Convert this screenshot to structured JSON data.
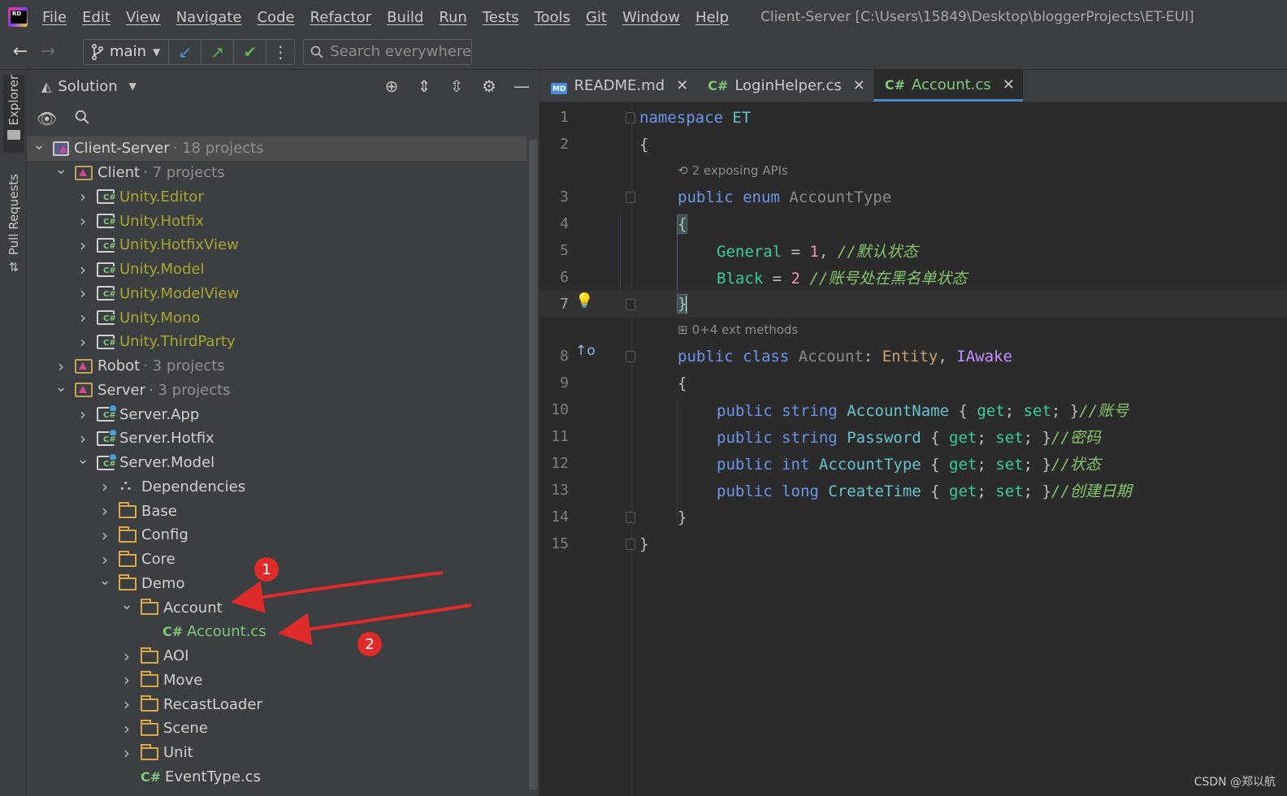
{
  "menu": {
    "items": [
      "File",
      "Edit",
      "View",
      "Navigate",
      "Code",
      "Refactor",
      "Build",
      "Run",
      "Tests",
      "Tools",
      "Git",
      "Window",
      "Help"
    ],
    "window_title": "Client-Server [C:\\Users\\15849\\Desktop\\bloggerProjects\\ET-EUI]"
  },
  "toolbar": {
    "back_icon": "arrow-left-icon",
    "forward_icon": "arrow-right-icon",
    "branch": "main",
    "search_placeholder": "Search everywhere",
    "colors": {
      "update": "#4a8fe0",
      "push": "#5ab34d",
      "commit": "#5ab34d"
    }
  },
  "side_strip": {
    "explorer": "Explorer",
    "pull_requests": "Pull Requests"
  },
  "explorer": {
    "title": "Solution",
    "tree": [
      {
        "label": "Client-Server",
        "meta": "· 18 projects",
        "level": 0,
        "expanded": true,
        "icon": "solution-icon",
        "style": "normal",
        "selected": true
      },
      {
        "label": "Client",
        "meta": "· 7 projects",
        "level": 1,
        "expanded": true,
        "icon": "solution-folder-icon",
        "style": "normal"
      },
      {
        "label": "Unity.Editor",
        "meta": "",
        "level": 2,
        "expanded": false,
        "icon": "csharp-project-icon",
        "style": "unity"
      },
      {
        "label": "Unity.Hotfix",
        "meta": "",
        "level": 2,
        "expanded": false,
        "icon": "csharp-project-icon",
        "style": "unity"
      },
      {
        "label": "Unity.HotfixView",
        "meta": "",
        "level": 2,
        "expanded": false,
        "icon": "csharp-project-icon",
        "style": "unity"
      },
      {
        "label": "Unity.Model",
        "meta": "",
        "level": 2,
        "expanded": false,
        "icon": "csharp-project-icon",
        "style": "unity"
      },
      {
        "label": "Unity.ModelView",
        "meta": "",
        "level": 2,
        "expanded": false,
        "icon": "csharp-project-icon",
        "style": "unity"
      },
      {
        "label": "Unity.Mono",
        "meta": "",
        "level": 2,
        "expanded": false,
        "icon": "csharp-project-icon",
        "style": "unity"
      },
      {
        "label": "Unity.ThirdParty",
        "meta": "",
        "level": 2,
        "expanded": false,
        "icon": "csharp-project-icon",
        "style": "unity"
      },
      {
        "label": "Robot",
        "meta": "· 3 projects",
        "level": 1,
        "expanded": false,
        "icon": "solution-folder-icon",
        "style": "normal"
      },
      {
        "label": "Server",
        "meta": "· 3 projects",
        "level": 1,
        "expanded": true,
        "icon": "solution-folder-icon",
        "style": "normal"
      },
      {
        "label": "Server.App",
        "meta": "",
        "level": 2,
        "expanded": false,
        "icon": "server-project-icon",
        "style": "normal"
      },
      {
        "label": "Server.Hotfix",
        "meta": "",
        "level": 2,
        "expanded": false,
        "icon": "server-project-icon",
        "style": "normal"
      },
      {
        "label": "Server.Model",
        "meta": "",
        "level": 2,
        "expanded": true,
        "icon": "server-project-icon",
        "style": "normal"
      },
      {
        "label": "Dependencies",
        "meta": "",
        "level": 3,
        "expanded": false,
        "icon": "dependencies-icon",
        "style": "normal"
      },
      {
        "label": "Base",
        "meta": "",
        "level": 3,
        "expanded": false,
        "icon": "folder-icon",
        "style": "normal"
      },
      {
        "label": "Config",
        "meta": "",
        "level": 3,
        "expanded": false,
        "icon": "folder-icon",
        "style": "normal"
      },
      {
        "label": "Core",
        "meta": "",
        "level": 3,
        "expanded": false,
        "icon": "folder-icon",
        "style": "normal"
      },
      {
        "label": "Demo",
        "meta": "",
        "level": 3,
        "expanded": true,
        "icon": "folder-icon",
        "style": "normal"
      },
      {
        "label": "Account",
        "meta": "",
        "level": 4,
        "expanded": true,
        "icon": "folder-icon",
        "style": "normal"
      },
      {
        "label": "Account.cs",
        "meta": "",
        "level": 5,
        "expanded": null,
        "icon": "csharp-file-icon",
        "style": "green"
      },
      {
        "label": "AOI",
        "meta": "",
        "level": 4,
        "expanded": false,
        "icon": "folder-icon",
        "style": "normal"
      },
      {
        "label": "Move",
        "meta": "",
        "level": 4,
        "expanded": false,
        "icon": "folder-icon",
        "style": "normal"
      },
      {
        "label": "RecastLoader",
        "meta": "",
        "level": 4,
        "expanded": false,
        "icon": "folder-icon",
        "style": "normal"
      },
      {
        "label": "Scene",
        "meta": "",
        "level": 4,
        "expanded": false,
        "icon": "folder-icon",
        "style": "normal"
      },
      {
        "label": "Unit",
        "meta": "",
        "level": 4,
        "expanded": false,
        "icon": "folder-icon",
        "style": "normal"
      },
      {
        "label": "EventType.cs",
        "meta": "",
        "level": 4,
        "expanded": null,
        "icon": "csharp-file-icon",
        "style": "normal"
      }
    ]
  },
  "editor": {
    "tabs": [
      {
        "label": "README.md",
        "icon": "markdown-icon",
        "active": false
      },
      {
        "label": "LoginHelper.cs",
        "icon": "csharp-file-icon",
        "active": false
      },
      {
        "label": "Account.cs",
        "icon": "csharp-file-icon",
        "active": true
      }
    ],
    "hints": {
      "enum_hint": "2 exposing APIs",
      "class_hint": "0+4 ext methods"
    },
    "line_numbers": [
      "1",
      "2",
      "3",
      "4",
      "5",
      "6",
      "7",
      "8",
      "9",
      "10",
      "11",
      "12",
      "13",
      "14",
      "15"
    ],
    "code": {
      "l1_kw": "namespace",
      "l1_name": "ET",
      "l2": "{",
      "l3_kw1": "public",
      "l3_kw2": "enum",
      "l3_name": "AccountType",
      "l4": "{",
      "l5_member": "General",
      "l5_eq": " = ",
      "l5_val": "1",
      "l5_comma": ", ",
      "l5_comment": "//默认状态",
      "l6_member": "Black",
      "l6_eq": " = ",
      "l6_val": "2",
      "l6_comment": " //账号处在黑名单状态",
      "l7": "}",
      "l8_kw1": "public",
      "l8_kw2": "class",
      "l8_name": "Account",
      "l8_colon": ": ",
      "l8_base1": "Entity",
      "l8_comma": ", ",
      "l8_base2": "IAwake",
      "l9": "{",
      "props": [
        {
          "type": "string",
          "name": "AccountName",
          "comment": "//账号",
          "sp": " "
        },
        {
          "type": "string",
          "name": "Password",
          "comment": "//密码",
          "sp": ""
        },
        {
          "type": "int",
          "name": "AccountType",
          "comment": "//状态",
          "sp": ""
        },
        {
          "type": "long",
          "name": "CreateTime",
          "comment": "//创建日期",
          "sp": ""
        }
      ],
      "prop_kw": "public",
      "get": "get",
      "set": "set",
      "l14": "}",
      "l15": "}"
    }
  },
  "annotations": {
    "badge_1": "1",
    "badge_2": "2",
    "color": "#e02b2b"
  },
  "watermark": "CSDN @郑以航"
}
